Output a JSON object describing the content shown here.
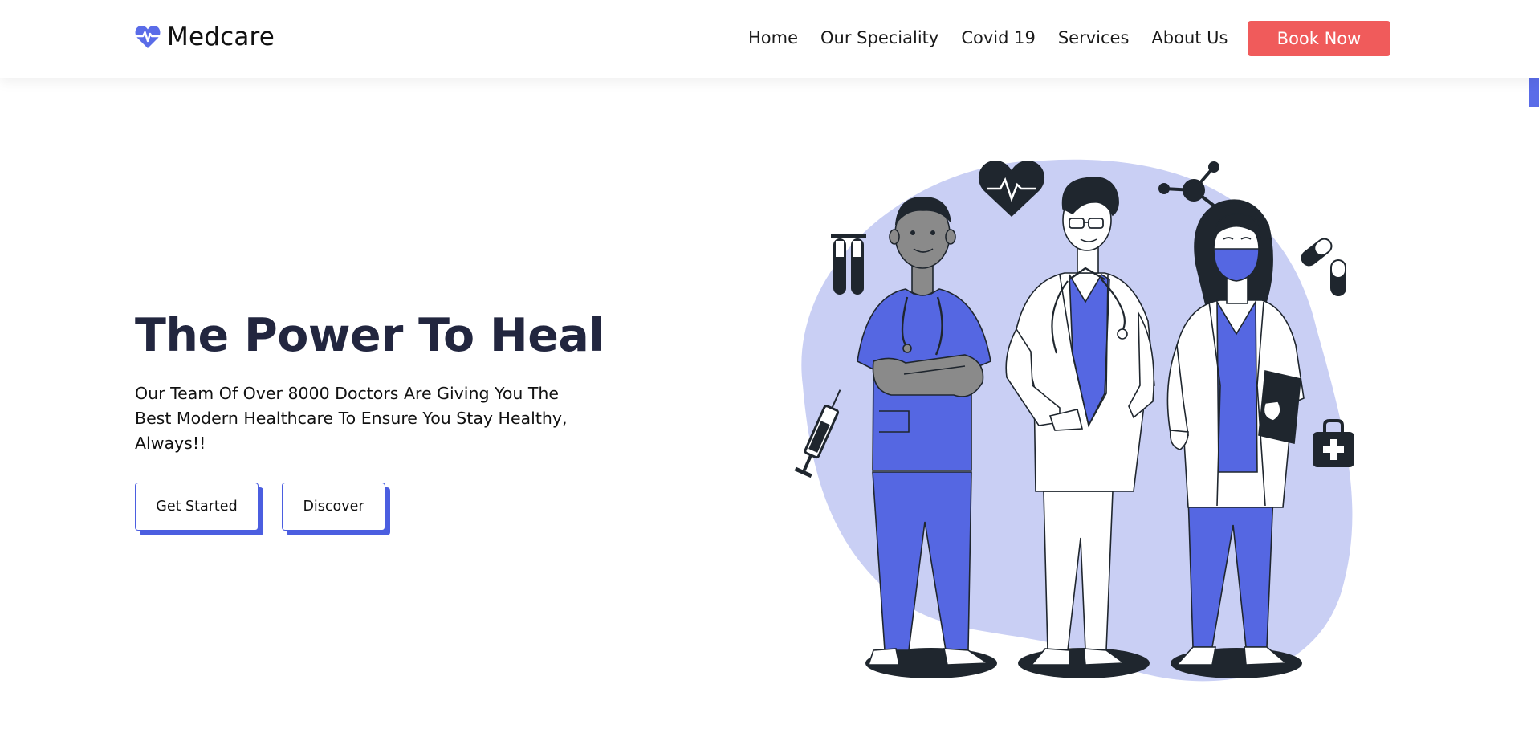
{
  "brand": {
    "name": "Medcare",
    "icon": "heartbeat-icon"
  },
  "nav": {
    "items": [
      {
        "label": "Home"
      },
      {
        "label": "Our Speciality"
      },
      {
        "label": "Covid 19"
      },
      {
        "label": "Services"
      },
      {
        "label": "About Us"
      }
    ],
    "cta_label": "Book Now"
  },
  "hero": {
    "title": "The Power To Heal",
    "description": "Our Team Of Over 8000 Doctors Are Giving You The Best Modern Healthcare To Ensure You Stay Healthy, Always!!",
    "buttons": [
      {
        "label": "Get Started"
      },
      {
        "label": "Discover"
      }
    ]
  },
  "colors": {
    "accent": "#4b5ee0",
    "cta": "#f05b5b",
    "title": "#22263f",
    "blob": "#c9cff4"
  }
}
